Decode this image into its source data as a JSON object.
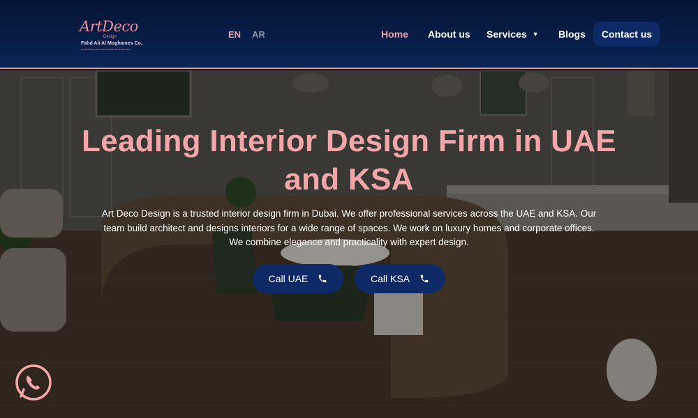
{
  "header": {
    "logo": {
      "main": "ArtDeco",
      "sub_line": "Design",
      "company": "Fahd Ali Al Moghames Co.",
      "tagline": "contracting and real estate development"
    },
    "languages": [
      {
        "label": "EN",
        "active": true
      },
      {
        "label": "AR",
        "active": false
      }
    ],
    "nav": {
      "home": "Home",
      "about": "About us",
      "services": "Services",
      "blogs": "Blogs",
      "contact": "Contact us"
    }
  },
  "hero": {
    "headline": "Leading Interior Design Firm in UAE and KSA",
    "description": "Art Deco Design is a trusted interior design firm in Dubai. We offer professional services across the UAE and KSA. Our team build architect and designs interiors for a wide range of spaces. We work on luxury homes and corporate offices. We combine elegance and practicality with expert design.",
    "buttons": {
      "call_uae": "Call UAE",
      "call_ksa": "Call KSA"
    }
  },
  "icons": {
    "phone": "phone-icon",
    "chevron": "chevron-down-icon",
    "whatsapp": "whatsapp-icon"
  },
  "colors": {
    "navy": "#0e2a66",
    "accent_pink": "#f4a7aa",
    "header_bg": "#041433"
  }
}
